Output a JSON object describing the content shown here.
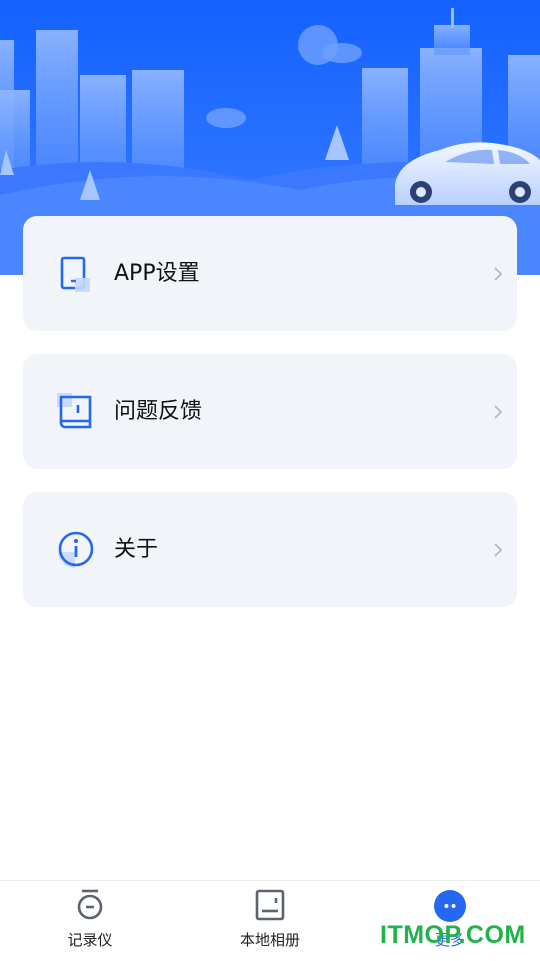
{
  "menu": [
    {
      "label": "APP设置",
      "icon": "settings-tablet-icon"
    },
    {
      "label": "问题反馈",
      "icon": "feedback-book-icon"
    },
    {
      "label": "关于",
      "icon": "info-icon"
    }
  ],
  "tabbar": {
    "tabs": [
      {
        "label": "记录仪",
        "icon": "recorder-icon",
        "active": false
      },
      {
        "label": "本地相册",
        "icon": "album-icon",
        "active": false
      },
      {
        "label": "更多",
        "icon": "more-icon",
        "active": true
      }
    ]
  },
  "watermark": "ITMOP.COM",
  "colors": {
    "accent": "#2468f2",
    "card_bg": "#f1f4f9",
    "hero_top": "#1763ff",
    "watermark": "#22b24c"
  }
}
